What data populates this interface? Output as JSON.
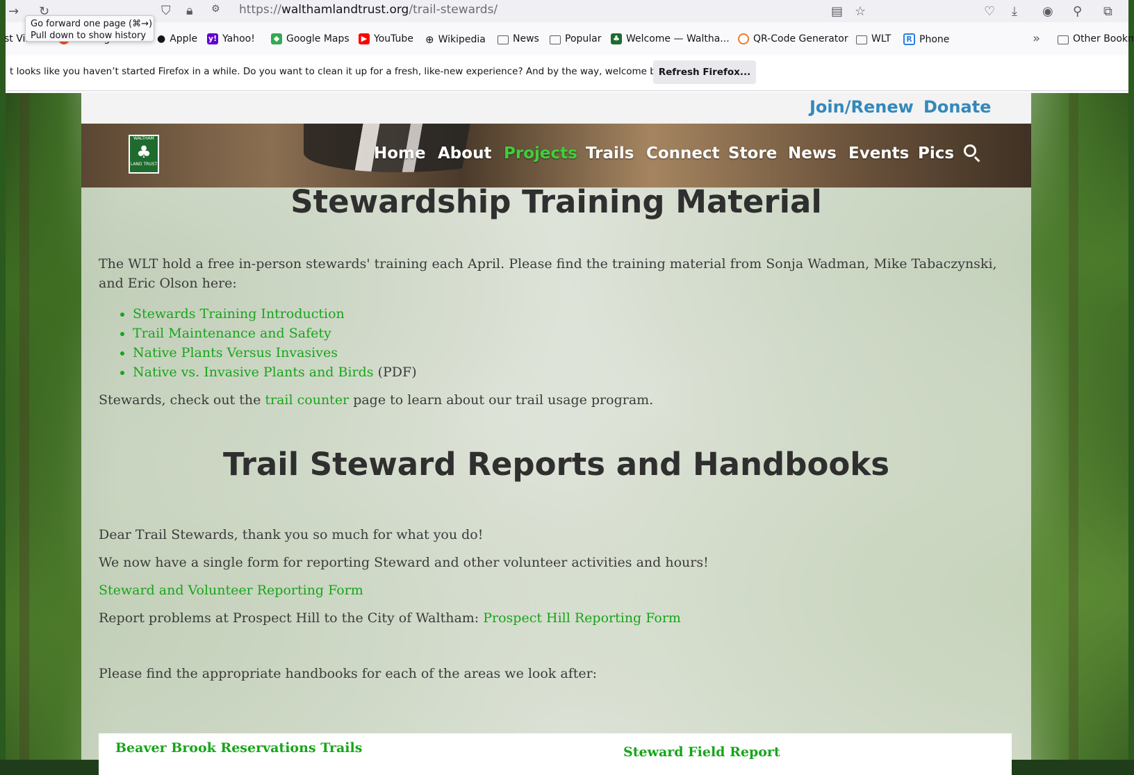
{
  "browser": {
    "url_scheme": "https://",
    "url_host": "walthamlandtrust.org",
    "url_path": "/trail-stewards/",
    "tooltip": [
      "Go forward one page (⌘→)",
      "Pull down to show history"
    ],
    "bookmarks": [
      {
        "label": "st Visited",
        "icon": "none"
      },
      {
        "label": "Getting Started",
        "icon": "firefox-icon"
      },
      {
        "label": "Apple",
        "icon": "apple-icon"
      },
      {
        "label": "Yahoo!",
        "icon": "yahoo-icon"
      },
      {
        "label": "Google Maps",
        "icon": "maps-icon"
      },
      {
        "label": "YouTube",
        "icon": "youtube-icon"
      },
      {
        "label": "Wikipedia",
        "icon": "globe-icon"
      },
      {
        "label": "News",
        "icon": "folder-icon"
      },
      {
        "label": "Popular",
        "icon": "folder-icon"
      },
      {
        "label": "Welcome — Waltha...",
        "icon": "wlt-icon"
      },
      {
        "label": "QR-Code Generator",
        "icon": "qr-icon"
      },
      {
        "label": "WLT",
        "icon": "folder-icon"
      },
      {
        "label": "Phone",
        "icon": "phone-icon"
      },
      {
        "label": "Other Bookm",
        "icon": "folder-icon"
      }
    ],
    "notice": {
      "text": "t looks like you haven’t started Firefox in a while. Do you want to clean it up for a fresh, like-new experience? And by the way, welcome back!",
      "button": "Refresh Firefox..."
    }
  },
  "site": {
    "top_links": {
      "join": "Join/Renew",
      "donate": "Donate"
    },
    "logo_text": [
      "WALTHAM",
      "LAND TRUST"
    ],
    "nav": [
      "Home",
      "About",
      "Projects",
      "Trails",
      "Connect",
      "Store",
      "News",
      "Events",
      "Pics"
    ],
    "active_nav": "Projects",
    "section1": {
      "title": "Stewardship Training Material",
      "intro_line1": "The WLT hold a free in-person stewards' training each April. Please find the training material from Sonja Wadman, Mike Tabaczynski,",
      "intro_line2": "and Eric Olson here:",
      "links": [
        "Stewards Training Introduction",
        "Trail Maintenance and Safety",
        "Native Plants Versus Invasives",
        "Native vs. Invasive Plants and Birds"
      ],
      "pdf_note": "(PDF)",
      "counter_before": "Stewards, check out the ",
      "counter_link": "trail counter",
      "counter_after": " page to learn about our trail usage program."
    },
    "section2": {
      "title": "Trail Steward Reports and Handbooks",
      "thanks": "Dear Trail Stewards, thank you so much for what you do!",
      "single_form": "We now have a single form for reporting Steward and other volunteer activities and hours!",
      "form_link": "Steward and Volunteer Reporting Form",
      "prospect_before": "Report problems at Prospect Hill to the City of Waltham: ",
      "prospect_link": "Prospect Hill Reporting Form",
      "handbooks": "Please find the appropriate handbooks for each of the areas we look after:",
      "card_left": "Beaver Brook Reservations Trails",
      "card_right": "Steward Field Report"
    }
  },
  "colors": {
    "link": "#17a51a",
    "top_link": "#3388bb",
    "active_nav": "#3fcf3a"
  }
}
